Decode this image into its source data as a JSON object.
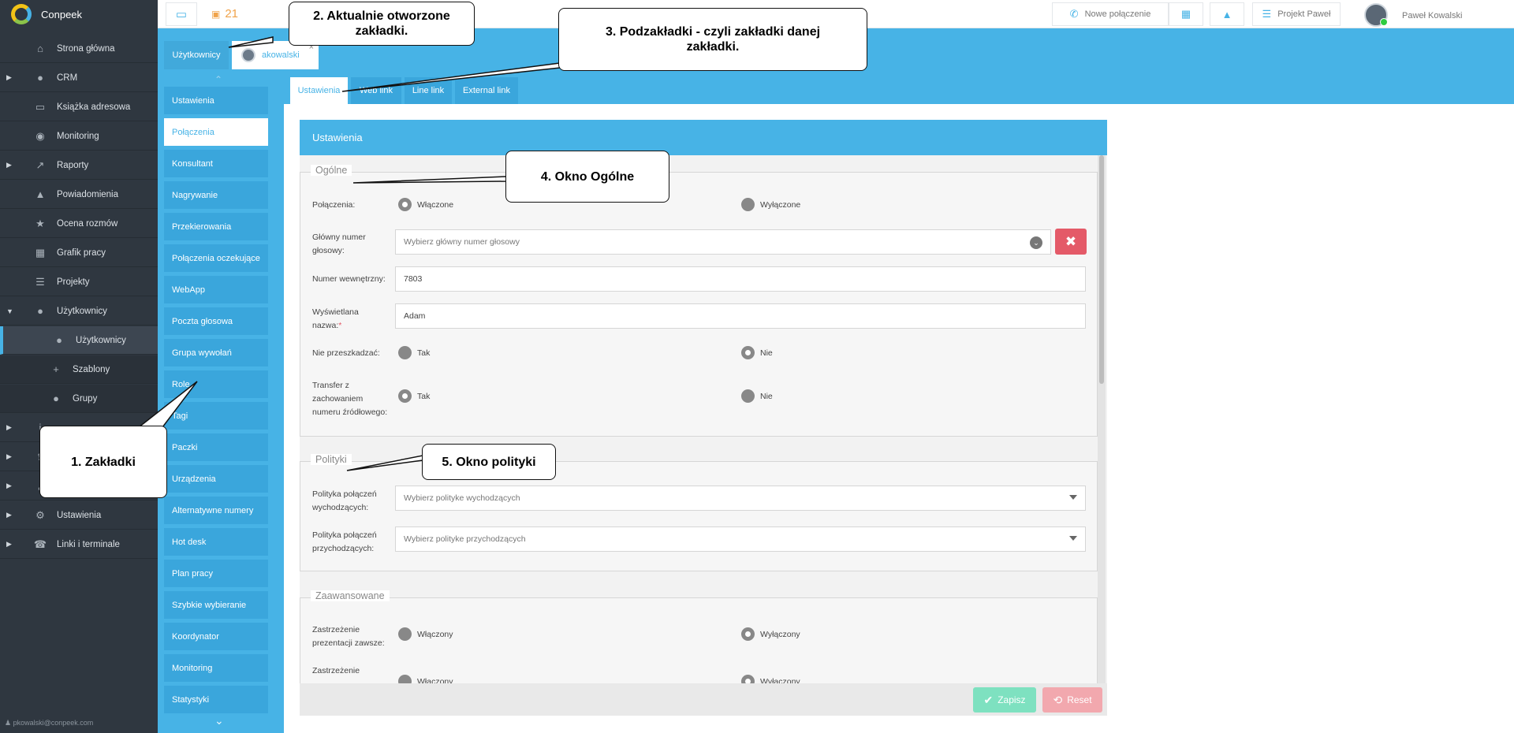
{
  "brand": {
    "name": "Conpeek"
  },
  "sidebar": {
    "items": [
      {
        "label": "Strona główna",
        "icon": "home-icon",
        "glyph": "⌂"
      },
      {
        "label": "CRM",
        "icon": "crm-person-icon",
        "glyph": "●",
        "caret": "▶"
      },
      {
        "label": "Książka adresowa",
        "icon": "address-card-icon",
        "glyph": "▭"
      },
      {
        "label": "Monitoring",
        "icon": "eye-icon",
        "glyph": "◉"
      },
      {
        "label": "Raporty",
        "icon": "chart-line-icon",
        "glyph": "↗",
        "caret": "▶"
      },
      {
        "label": "Powiadomienia",
        "icon": "bell-icon",
        "glyph": "▲"
      },
      {
        "label": "Ocena rozmów",
        "icon": "star-icon",
        "glyph": "★"
      },
      {
        "label": "Grafik pracy",
        "icon": "calendar-icon",
        "glyph": "▦"
      },
      {
        "label": "Projekty",
        "icon": "list-check-icon",
        "glyph": "☰"
      },
      {
        "label": "Użytkownicy",
        "icon": "user-icon",
        "glyph": "●",
        "caret": "▼"
      },
      {
        "label": "Użytkownicy",
        "icon": "users-icon",
        "glyph": "●",
        "sub": true,
        "active": true
      },
      {
        "label": "Szablony",
        "icon": "user-plus-icon",
        "glyph": "+",
        "sub": true
      },
      {
        "label": "Grupy",
        "icon": "users-group-icon",
        "glyph": "●",
        "sub": true
      },
      {
        "label": "",
        "icon": "info-icon",
        "glyph": "i",
        "caret": "▶"
      },
      {
        "label": "",
        "icon": "upload-icon",
        "glyph": "⇪",
        "caret": "▶"
      },
      {
        "label": "",
        "icon": "key-icon",
        "glyph": "⚷",
        "caret": "▶"
      },
      {
        "label": "Ustawienia",
        "icon": "gears-icon",
        "glyph": "⚙",
        "caret": "▶"
      },
      {
        "label": "Linki i terminale",
        "icon": "phone-terminal-icon",
        "glyph": "☎",
        "caret": "▶"
      }
    ],
    "user_email": "pkowalski@conpeek.com"
  },
  "topbar": {
    "monitor_icon": "monitor-icon",
    "ticket_icon": "ticket-icon",
    "ticket_count": "21",
    "new_call": "Nowe połączenie",
    "calendar_icon": "calendar-icon",
    "bell_icon": "bell-icon",
    "project": "Projekt Paweł",
    "user_name": "Paweł Kowalski",
    "status_color": "#2ecc40"
  },
  "tabs": {
    "section": "Użytkownicy",
    "open_user": "akowalski",
    "close": "×"
  },
  "left_nav": [
    "Ustawienia",
    "Połączenia",
    "Konsultant",
    "Nagrywanie",
    "Przekierowania",
    "Połączenia oczekujące",
    "WebApp",
    "Poczta głosowa",
    "Grupa wywołań",
    "Role",
    "Tagi",
    "Paczki",
    "Urządzenia",
    "Alternatywne numery",
    "Hot desk",
    "Plan pracy",
    "Szybkie wybieranie",
    "Koordynator",
    "Monitoring",
    "Statystyki"
  ],
  "left_nav_active": "Połączenia",
  "subtabs": [
    "Ustawienia",
    "Web link",
    "Line link",
    "External link"
  ],
  "panel": {
    "title": "Ustawienia",
    "general": {
      "legend": "Ogólne",
      "connections_label": "Połączenia:",
      "conn_on": "Włączone",
      "conn_off": "Wyłączone",
      "main_number_label": "Główny numer głosowy:",
      "main_number_placeholder": "Wybierz główny numer głosowy",
      "internal_label": "Numer wewnętrzny:",
      "internal_value": "7803",
      "display_label": "Wyświetlana nazwa:",
      "required_mark": "*",
      "display_value": "Adam",
      "dnd_label": "Nie przeszkadzać:",
      "yes": "Tak",
      "no": "Nie",
      "transfer_label": "Transfer z zachowaniem numeru źródłowego:"
    },
    "policies": {
      "legend": "Polityki",
      "out_label": "Polityka połączeń wychodzących:",
      "out_placeholder": "Wybierz polityke wychodzących",
      "in_label": "Polityka połączeń przychodzących:",
      "in_placeholder": "Wybierz polityke przychodzących"
    },
    "advanced": {
      "legend": "Zaawansowane",
      "always_label": "Zastrzeżenie prezentacji zawsze:",
      "on": "Włączony",
      "off": "Wyłączony",
      "second_label": "Zastrzeżenie"
    },
    "save": "Zapisz",
    "reset": "Reset"
  },
  "callouts": {
    "c1": "1. Zakładki",
    "c2": "2. Aktualnie otworzone zakładki.",
    "c3": "3. Podzakładki - czyli zakładki danej zakładki.",
    "c4": "4. Okno Ogólne",
    "c5": "5. Okno polityki"
  },
  "colors": {
    "accent": "#47b3e6",
    "sidebar": "#2f3740",
    "danger": "#e45a68",
    "save": "#7ee1c0"
  }
}
